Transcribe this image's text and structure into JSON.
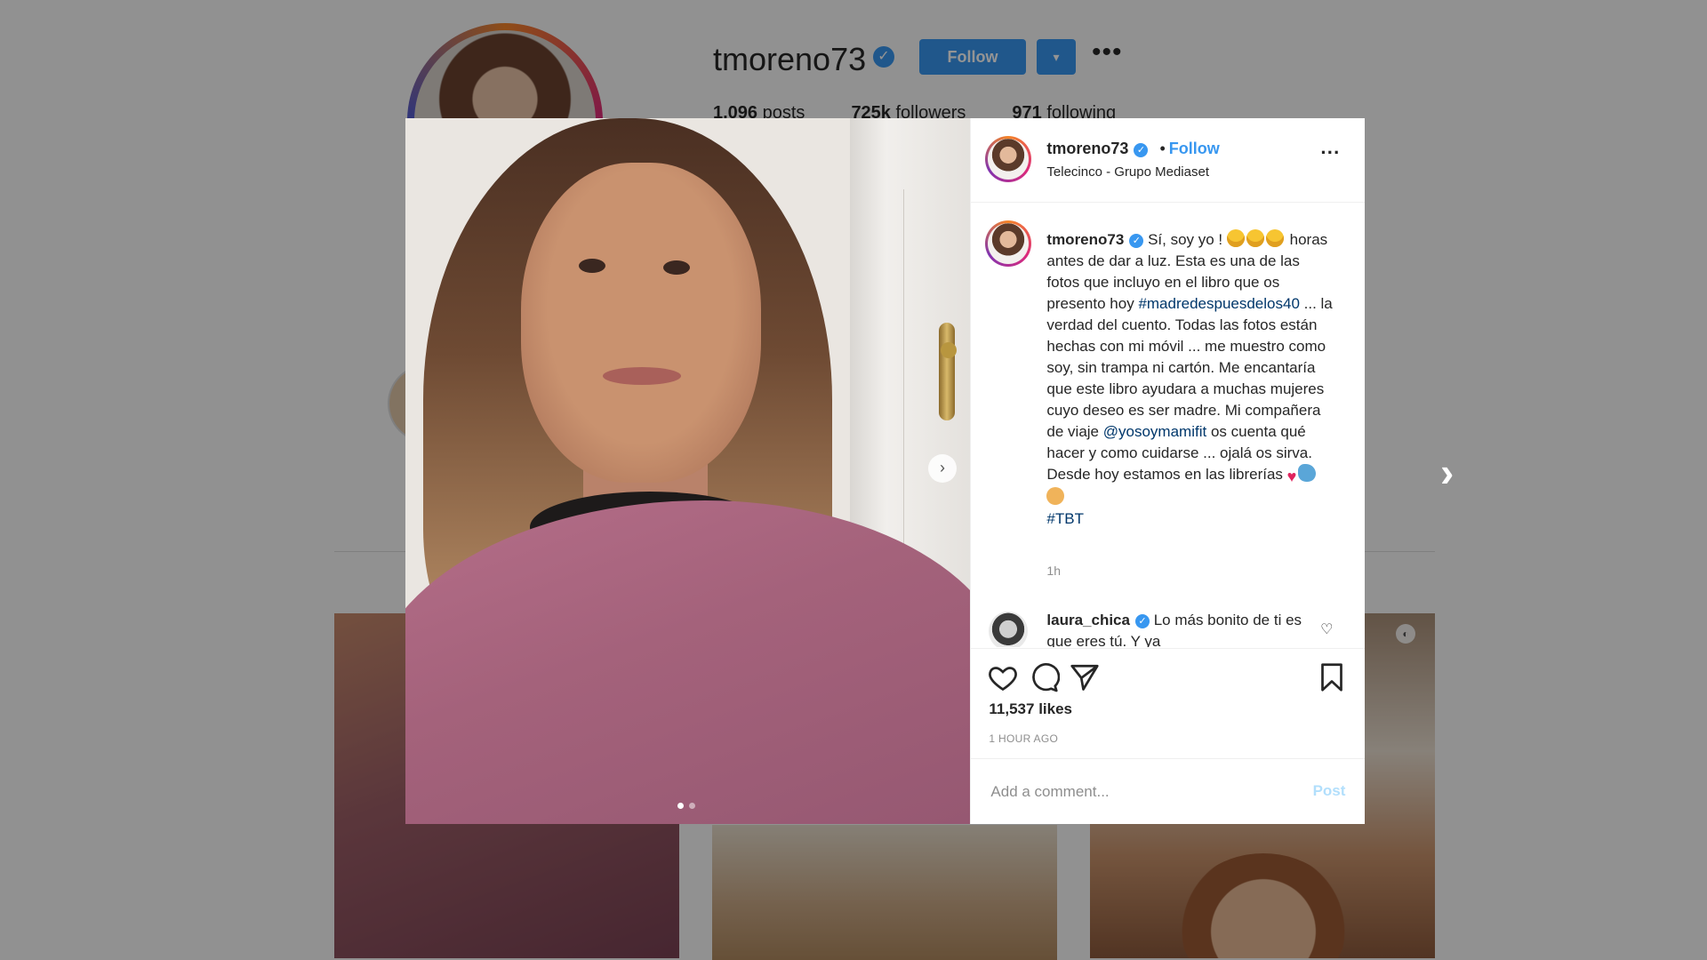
{
  "profile": {
    "username": "tmoreno73",
    "follow_label": "Follow",
    "dropdown_label": "▾",
    "more_label": "•••",
    "posts": "1,096",
    "posts_label": "posts",
    "followers": "725k",
    "followers_label": "followers",
    "following": "971",
    "following_label": "following"
  },
  "post": {
    "header": {
      "username": "tmoreno73",
      "separator": "•",
      "follow_label": "Follow",
      "location": "Telecinco - Grupo Mediaset",
      "more_label": "···"
    },
    "caption": {
      "username": "tmoreno73",
      "part1": "Sí, soy yo !",
      "part2": "horas antes de dar a luz. Esta es una de las fotos que incluyo en el libro que os presento hoy",
      "hashtag1": "#madredespuesdelos40",
      "part3": "... la verdad del cuento. Todas las fotos están hechas con mi móvil ... me muestro como soy, sin trampa ni cartón. Me encantaría que este libro ayudara a muchas mujeres cuyo deseo es ser madre. Mi compañera de viaje",
      "mention": "@yosoymamifit",
      "part4": "os cuenta qué hacer y como cuidarse ... ojalá os sirva. Desde hoy estamos en las librerías",
      "hashtag2": "#TBT",
      "time": "1h"
    },
    "comment": {
      "username": "laura_chica",
      "text": "Lo más bonito de ti es que eres tú. Y ya"
    },
    "likes": "11,537 likes",
    "time_ago": "1 HOUR AGO",
    "add_comment_placeholder": "Add a comment...",
    "post_label": "Post"
  },
  "icons": {
    "verified": "✓",
    "heart": "heart-icon",
    "comment": "comment-icon",
    "share": "share-icon",
    "bookmark": "bookmark-icon"
  },
  "colors": {
    "accent": "#3897f0",
    "text": "#262626",
    "muted": "#8e8e8e",
    "link": "#00376b"
  }
}
